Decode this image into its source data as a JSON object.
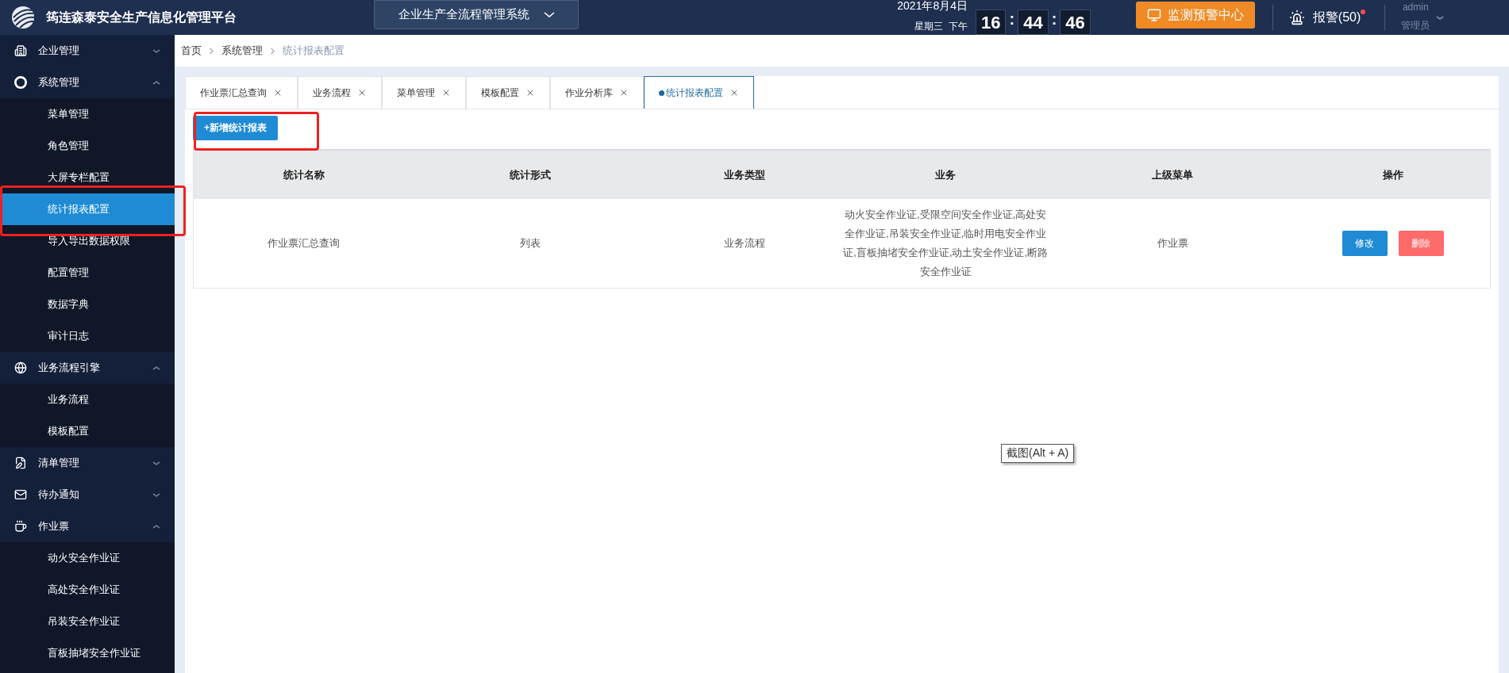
{
  "header": {
    "title": "筠连森泰安全生产信息化管理平台",
    "system_select": "企业生产全流程管理系统",
    "date": "2021年8月4日",
    "weekday": "星期三  下午",
    "clock": [
      "16",
      "44",
      "46"
    ],
    "clock_separator": ":",
    "monitor_button": "监测预警中心",
    "alarm": {
      "label": "报警(50)",
      "unread": true
    },
    "user": {
      "name": "admin",
      "role": "管理员"
    }
  },
  "sidebar": [
    {
      "label": "企业管理",
      "expanded": false
    },
    {
      "label": "系统管理",
      "expanded": true,
      "children": [
        {
          "label": "菜单管理",
          "selected": false
        },
        {
          "label": "角色管理",
          "selected": false
        },
        {
          "label": "大屏专栏配置",
          "selected": false
        },
        {
          "label": "统计报表配置",
          "selected": true
        },
        {
          "label": "导入导出数据权限",
          "selected": false
        },
        {
          "label": "配置管理",
          "selected": false
        },
        {
          "label": "数据字典",
          "selected": false
        },
        {
          "label": "审计日志",
          "selected": false
        }
      ]
    },
    {
      "label": "业务流程引擎",
      "expanded": true,
      "children": [
        {
          "label": "业务流程",
          "selected": false
        },
        {
          "label": "模板配置",
          "selected": false
        }
      ]
    },
    {
      "label": "清单管理",
      "expanded": false
    },
    {
      "label": "待办通知",
      "expanded": false
    },
    {
      "label": "作业票",
      "expanded": true,
      "children": [
        {
          "label": "动火安全作业证",
          "selected": false
        },
        {
          "label": "高处安全作业证",
          "selected": false
        },
        {
          "label": "吊装安全作业证",
          "selected": false
        },
        {
          "label": "盲板抽堵安全作业证",
          "selected": false
        }
      ]
    }
  ],
  "breadcrumb": [
    "首页",
    "系统管理",
    "统计报表配置"
  ],
  "tabs": [
    {
      "label": "作业票汇总查询",
      "selected": false
    },
    {
      "label": "业务流程",
      "selected": false
    },
    {
      "label": "菜单管理",
      "selected": false
    },
    {
      "label": "模板配置",
      "selected": false
    },
    {
      "label": "作业分析库",
      "selected": false
    },
    {
      "label": "统计报表配置",
      "selected": true
    }
  ],
  "add_button": "+新增统计报表",
  "table": {
    "columns": [
      "统计名称",
      "统计形式",
      "业务类型",
      "业务",
      "上级菜单",
      "操作"
    ],
    "rows": [
      {
        "cells": [
          "作业票汇总查询",
          "列表",
          "业务流程",
          "动火安全作业证,受限空间安全作业证,高处安全作业证,吊装安全作业证,临时用电安全作业证,盲板抽堵安全作业证,动土安全作业证,断路安全作业证",
          "作业票"
        ],
        "actions": [
          {
            "label": "修改",
            "kind": "edit"
          },
          {
            "label": "删除",
            "kind": "delete"
          }
        ]
      }
    ]
  },
  "tooltip": "截图(Alt + A)"
}
